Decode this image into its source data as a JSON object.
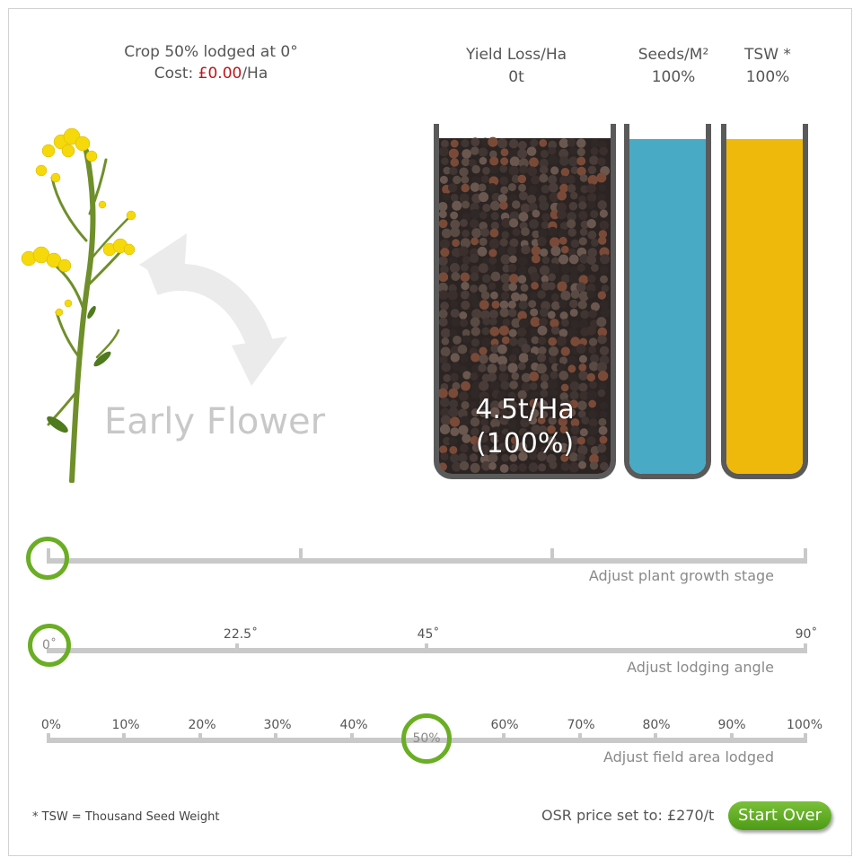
{
  "header": {
    "lodged_text": "Crop 50% lodged at 0°",
    "cost_prefix": "Cost: ",
    "cost_value": "£0.00",
    "cost_suffix": "/Ha"
  },
  "stats": {
    "yield_loss": {
      "label": "Yield Loss/Ha",
      "value": "0t"
    },
    "seeds": {
      "label": "Seeds/M²",
      "value": "100%"
    },
    "tsw": {
      "label": "TSW *",
      "value": "100%"
    }
  },
  "visual": {
    "stage_label": "Early Flower",
    "yield_amount": "4.5t/Ha",
    "yield_percent": "(100%)",
    "yield_fill_level": 1.0,
    "seeds_fill_level": 1.0,
    "tsw_fill_level": 1.0
  },
  "sliders": {
    "growth": {
      "caption": "Adjust plant growth stage",
      "stops": 4,
      "selected_index": 0
    },
    "angle": {
      "caption": "Adjust lodging angle",
      "labels": [
        "22.5˚",
        "45˚",
        "90˚"
      ],
      "knob_label": "0˚",
      "value": 0,
      "min": 0,
      "max": 90
    },
    "area": {
      "caption": "Adjust field area lodged",
      "labels": [
        "0%",
        "10%",
        "20%",
        "30%",
        "40%",
        "60%",
        "70%",
        "80%",
        "90%",
        "100%"
      ],
      "knob_label": "50%",
      "value": 50
    }
  },
  "footer": {
    "footnote": "* TSW = Thousand Seed Weight",
    "price": "OSR price set to: £270/t",
    "start_over": "Start Over"
  },
  "colors": {
    "accent_green": "#6aae24",
    "seeds_blue": "#48aac5",
    "tsw_yellow": "#efb90c",
    "cost_red": "#c0141a",
    "tube_border": "#5a5a5a"
  }
}
